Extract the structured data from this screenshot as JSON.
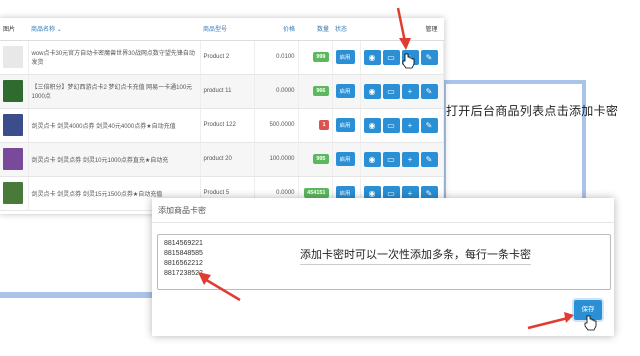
{
  "table": {
    "headers": {
      "image": "图片",
      "name": "商品名称",
      "model": "商品型号",
      "price": "价格",
      "stock": "数量",
      "status": "状态",
      "manage": "管理"
    },
    "rows": [
      {
        "name": "wow点卡30元官方自动卡密魔兽世界30战网点数守望先锋自动发货",
        "model": "Product 2",
        "price": "0.0100",
        "stock": "999",
        "stock_color": "green",
        "status": "启用",
        "thumb": "#e8e8e8"
      },
      {
        "name": "【三倍积分】梦幻西游点卡2 梦幻点卡充值 网易一卡通100元1000点",
        "model": "product 11",
        "price": "0.0000",
        "stock": "966",
        "stock_color": "green",
        "status": "启用",
        "thumb": "#2f6b2f"
      },
      {
        "name": "剑灵点卡 剑灵4000点券 剑灵40元4000点券★自动充值",
        "model": "Product 122",
        "price": "500.0000",
        "stock": "1",
        "stock_color": "red",
        "status": "启用",
        "thumb": "#3d4c8a"
      },
      {
        "name": "剑灵点卡 剑灵点券 剑灵10元1000点券直充★自动充",
        "model": "product 20",
        "price": "100.0000",
        "stock": "995",
        "stock_color": "green",
        "status": "启用",
        "thumb": "#7a4a9a"
      },
      {
        "name": "剑灵点卡 剑灵点券 剑灵15元1500点券★自动充值",
        "model": "Product 5",
        "price": "0.0000",
        "stock": "454151",
        "stock_color": "green",
        "status": "启用",
        "thumb": "#4a7a3a"
      }
    ],
    "op_icons": [
      "eye-icon",
      "card-icon",
      "plus-icon",
      "pencil-icon"
    ]
  },
  "callout": {
    "text": "打开后台商品列表点击添加卡密"
  },
  "dialog": {
    "title": "添加商品卡密",
    "textarea_value": "8814569221\n8815848585\n8816562212\n8817238522",
    "hint": "添加卡密时可以一次性添加多条，每行一条卡密",
    "save_label": "保存"
  },
  "colors": {
    "accent": "#2a8fd4",
    "frame": "#a9c4e8",
    "arrow": "#e03c31",
    "green_tag": "#5cb85c",
    "red_tag": "#d9534f"
  }
}
